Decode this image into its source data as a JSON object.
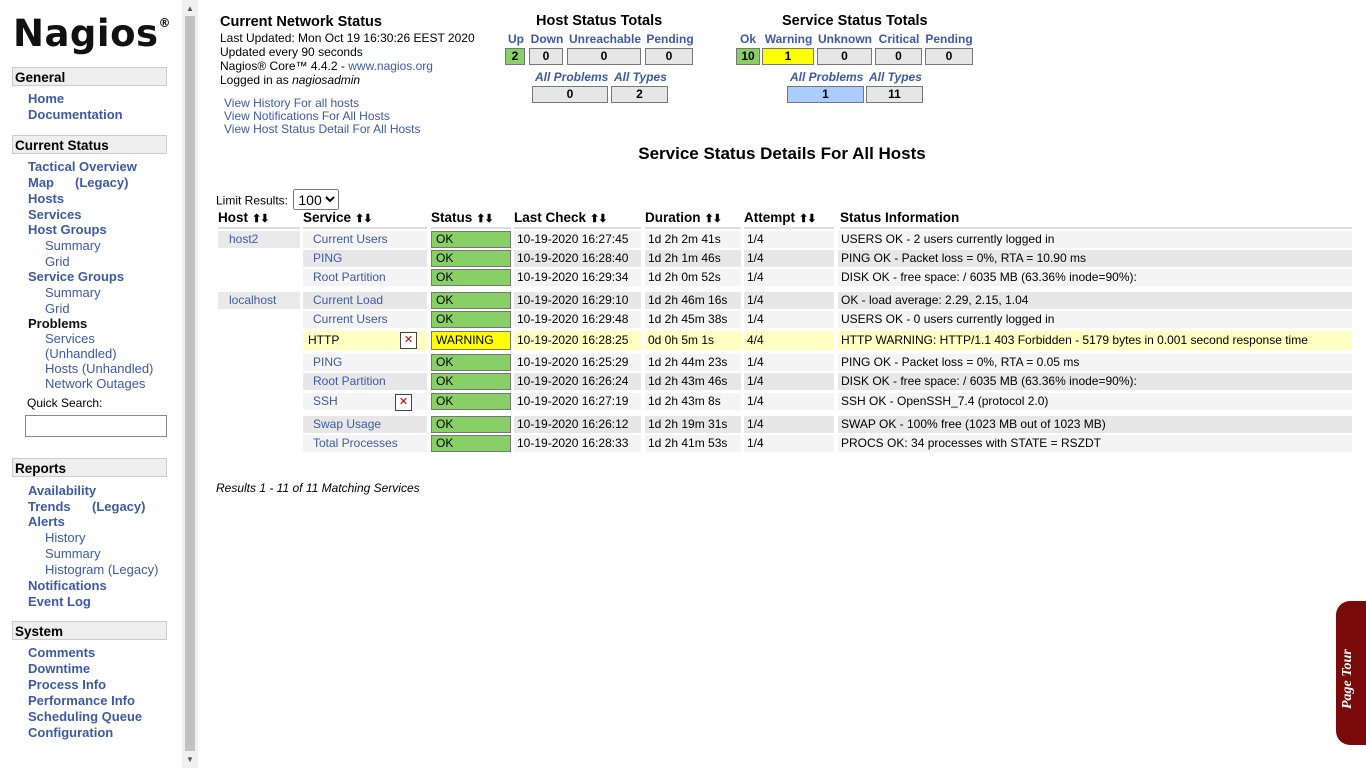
{
  "sidebar": {
    "logo": "Nagios",
    "logo_mark": "®",
    "general": {
      "title": "General",
      "items": [
        "Home",
        "Documentation"
      ]
    },
    "current_status": {
      "title": "Current Status",
      "tactical": "Tactical Overview",
      "map": "Map",
      "map_legacy": "(Legacy)",
      "hosts": "Hosts",
      "services": "Services",
      "host_groups": "Host Groups",
      "hg_summary": "Summary",
      "hg_grid": "Grid",
      "service_groups": "Service Groups",
      "sg_summary": "Summary",
      "sg_grid": "Grid",
      "problems": "Problems",
      "p_services": "Services",
      "p_unhandled": "(Unhandled)",
      "p_hosts": "Hosts (Unhandled)",
      "p_outages": "Network Outages",
      "quick_search": "Quick Search:"
    },
    "reports": {
      "title": "Reports",
      "availability": "Availability",
      "trends": "Trends",
      "trends_legacy": "(Legacy)",
      "alerts": "Alerts",
      "history": "History",
      "summary": "Summary",
      "histogram": "Histogram (Legacy)",
      "notifications": "Notifications",
      "event_log": "Event Log"
    },
    "system": {
      "title": "System",
      "items": [
        "Comments",
        "Downtime",
        "Process Info",
        "Performance Info",
        "Scheduling Queue",
        "Configuration"
      ]
    }
  },
  "info": {
    "title": "Current Network Status",
    "updated": "Last Updated: Mon Oct 19 16:30:26 EEST 2020",
    "every": "Updated every 90 seconds",
    "core": "Nagios® Core™ 4.4.2 - ",
    "core_link": "www.nagios.org",
    "logged_prefix": "Logged in as ",
    "user": "nagiosadmin"
  },
  "links": [
    "View History For all hosts",
    "View Notifications For All Hosts",
    "View Host Status Detail For All Hosts"
  ],
  "host_totals": {
    "title": "Host Status Totals",
    "headers": [
      "Up",
      "Down",
      "Unreachable",
      "Pending"
    ],
    "values": [
      "2",
      "0",
      "0",
      "0"
    ],
    "all_problems": "All Problems",
    "all_types": "All Types",
    "problems_value": "0",
    "types_value": "2"
  },
  "service_totals": {
    "title": "Service Status Totals",
    "headers": [
      "Ok",
      "Warning",
      "Unknown",
      "Critical",
      "Pending"
    ],
    "values": [
      "10",
      "1",
      "0",
      "0",
      "0"
    ],
    "all_problems": "All Problems",
    "all_types": "All Types",
    "problems_value": "1",
    "types_value": "11"
  },
  "page_title": "Service Status Details For All Hosts",
  "limit": {
    "label": "Limit Results:",
    "value": "100"
  },
  "columns": [
    "Host",
    "Service",
    "Status",
    "Last Check",
    "Duration",
    "Attempt",
    "Status Information"
  ],
  "sort_glyph": "⬆⬇",
  "rows": [
    {
      "host": "host2",
      "service": "Current Users",
      "status": "OK",
      "last": "10-19-2020 16:27:45",
      "duration": "1d 2h 2m 41s",
      "attempt": "1/4",
      "info": "USERS OK - 2 users currently logged in"
    },
    {
      "host": "",
      "service": "PING",
      "status": "OK",
      "last": "10-19-2020 16:28:40",
      "duration": "1d 2h 1m 46s",
      "attempt": "1/4",
      "info": "PING OK - Packet loss = 0%, RTA = 10.90 ms"
    },
    {
      "host": "",
      "service": "Root Partition",
      "status": "OK",
      "last": "10-19-2020 16:29:34",
      "duration": "1d 2h 0m 52s",
      "attempt": "1/4",
      "info": "DISK OK - free space: / 6035 MB (63.36% inode=90%):"
    },
    {
      "host": "localhost",
      "service": "Current Load",
      "status": "OK",
      "last": "10-19-2020 16:29:10",
      "duration": "1d 2h 46m 16s",
      "attempt": "1/4",
      "info": "OK - load average: 2.29, 2.15, 1.04"
    },
    {
      "host": "",
      "service": "Current Users",
      "status": "OK",
      "last": "10-19-2020 16:29:48",
      "duration": "1d 2h 45m 38s",
      "attempt": "1/4",
      "info": "USERS OK - 0 users currently logged in"
    },
    {
      "host": "",
      "service": "HTTP",
      "status": "WARNING",
      "last": "10-19-2020 16:28:25",
      "duration": "0d 0h 5m 1s",
      "attempt": "4/4",
      "info": "HTTP WARNING: HTTP/1.1 403 Forbidden - 5179 bytes in 0.001 second response time"
    },
    {
      "host": "",
      "service": "PING",
      "status": "OK",
      "last": "10-19-2020 16:25:29",
      "duration": "1d 2h 44m 23s",
      "attempt": "1/4",
      "info": "PING OK - Packet loss = 0%, RTA = 0.05 ms"
    },
    {
      "host": "",
      "service": "Root Partition",
      "status": "OK",
      "last": "10-19-2020 16:26:24",
      "duration": "1d 2h 43m 46s",
      "attempt": "1/4",
      "info": "DISK OK - free space: / 6035 MB (63.36% inode=90%):"
    },
    {
      "host": "",
      "service": "SSH",
      "status": "OK",
      "last": "10-19-2020 16:27:19",
      "duration": "1d 2h 43m 8s",
      "attempt": "1/4",
      "info": "SSH OK - OpenSSH_7.4 (protocol 2.0)"
    },
    {
      "host": "",
      "service": "Swap Usage",
      "status": "OK",
      "last": "10-19-2020 16:26:12",
      "duration": "1d 2h 19m 31s",
      "attempt": "1/4",
      "info": "SWAP OK - 100% free (1023 MB out of 1023 MB)"
    },
    {
      "host": "",
      "service": "Total Processes",
      "status": "OK",
      "last": "10-19-2020 16:28:33",
      "duration": "1d 2h 41m 53s",
      "attempt": "1/4",
      "info": "PROCS OK: 34 processes with STATE = RSZDT"
    }
  ],
  "results_text": "Results 1 - 11 of 11 Matching Services",
  "page_tour": "Page Tour",
  "colors": {
    "ok": "#88d066",
    "warning": "#ffff00",
    "link": "#3c5aa8",
    "tour": "#7a0a0a"
  }
}
